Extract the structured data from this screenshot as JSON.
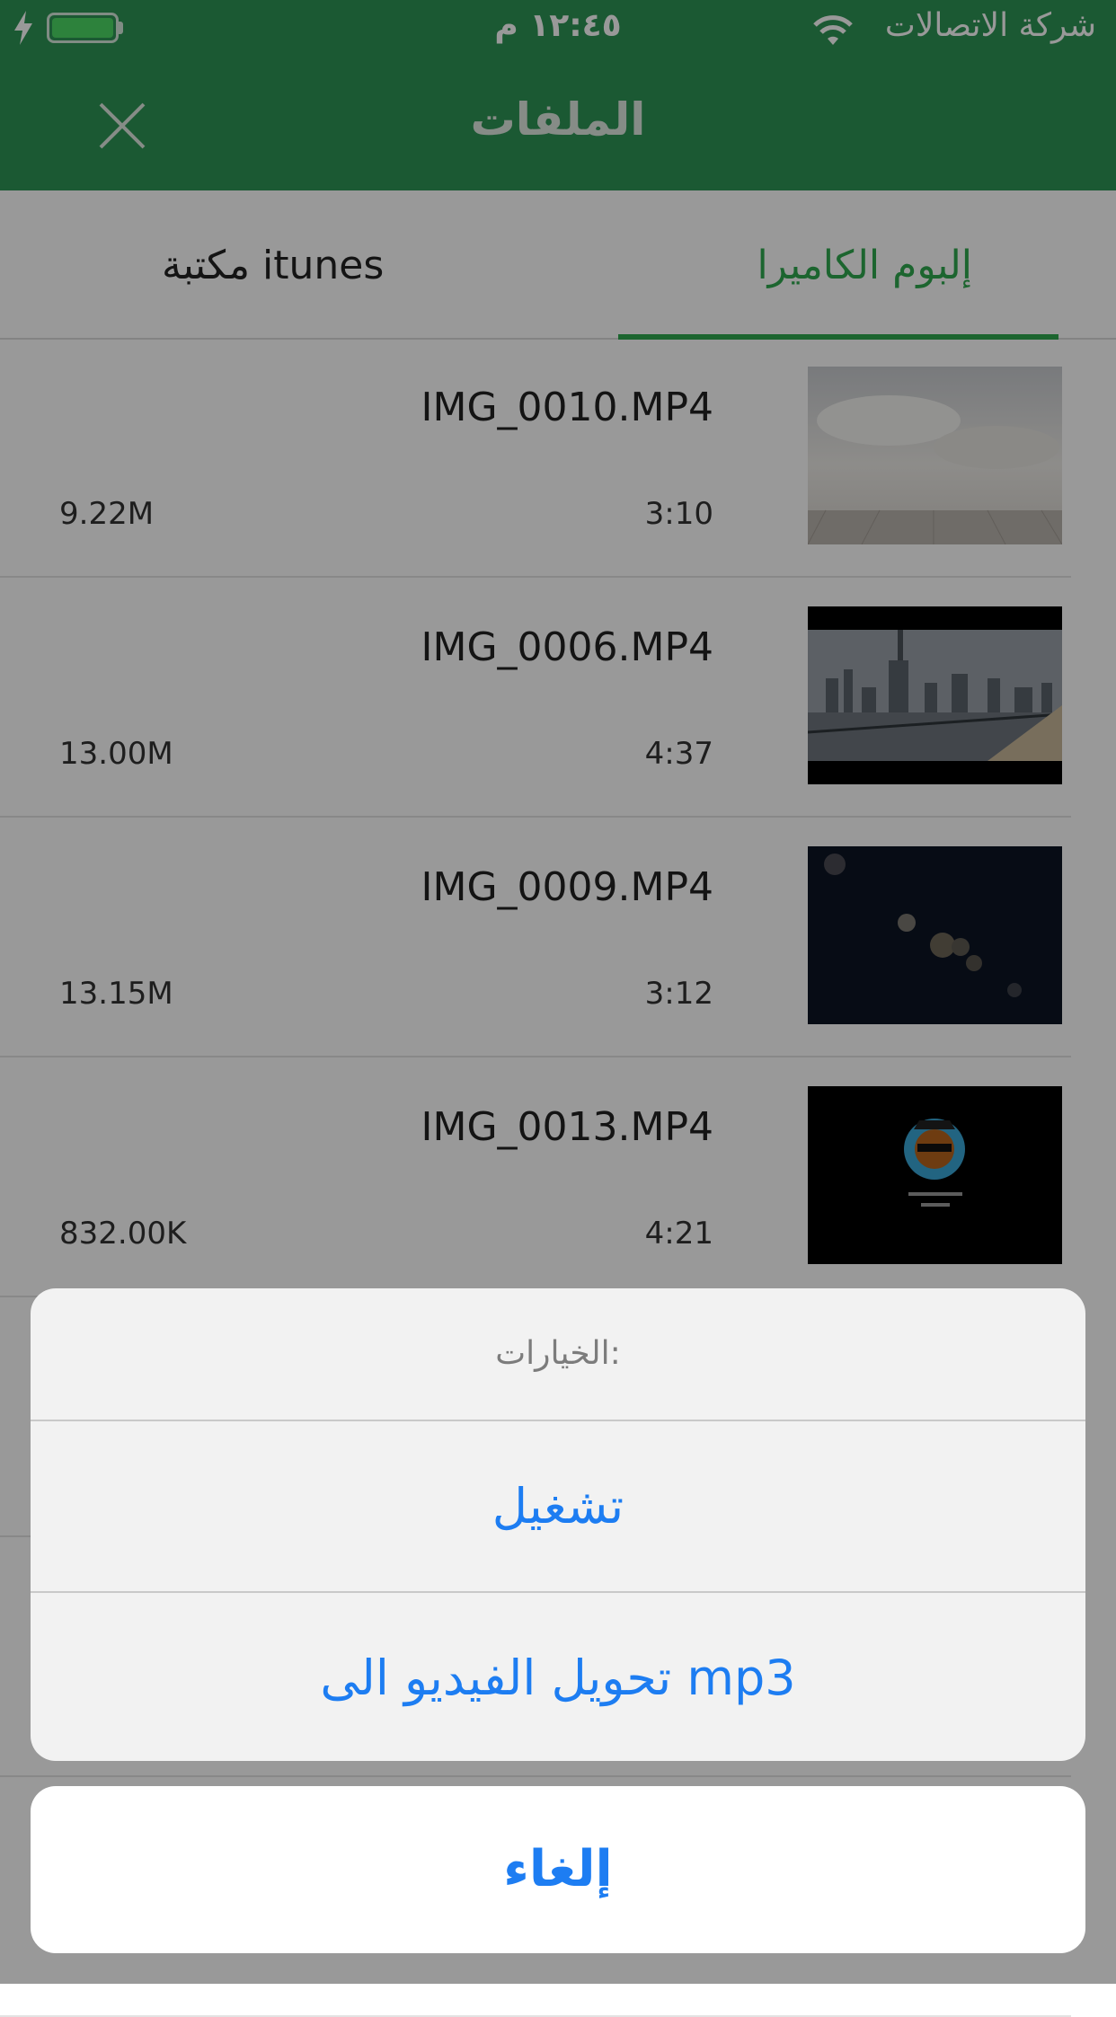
{
  "status_bar": {
    "carrier": "شركة الاتصالات",
    "time": "١٢:٤٥ م",
    "wifi_icon": "wifi-icon",
    "battery_icon": "battery-charging-icon"
  },
  "header": {
    "title": "الملفات",
    "close_icon": "close-icon",
    "background_color": "#2e9555"
  },
  "tabs": [
    {
      "label": "إلبوم الكاميرا",
      "active": true
    },
    {
      "label": "مكتبة itunes",
      "active": false
    }
  ],
  "files": [
    {
      "name": "IMG_0010.MP4",
      "duration": "3:10",
      "size": "9.22M",
      "thumb": "clouds"
    },
    {
      "name": "IMG_0006.MP4",
      "duration": "4:37",
      "size": "13.00M",
      "thumb": "city"
    },
    {
      "name": "IMG_0009.MP4",
      "duration": "3:12",
      "size": "13.15M",
      "thumb": "night"
    },
    {
      "name": "IMG_0013.MP4",
      "duration": "4:21",
      "size": "832.00K",
      "thumb": "logo"
    }
  ],
  "action_sheet": {
    "title": "الخيارات:",
    "options": [
      "تشغيل",
      "تحويل الفيديو الى mp3"
    ],
    "cancel": "إلغاء",
    "accent_color": "#1d7df2"
  }
}
